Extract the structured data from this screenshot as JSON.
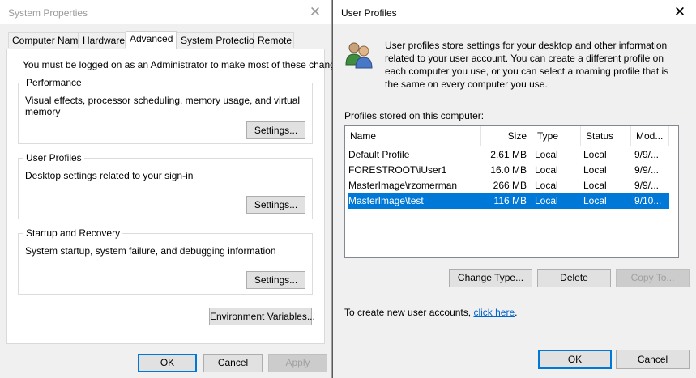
{
  "system_properties": {
    "title": "System Properties",
    "tabs": [
      {
        "label": "Computer Name"
      },
      {
        "label": "Hardware"
      },
      {
        "label": "Advanced"
      },
      {
        "label": "System Protection"
      },
      {
        "label": "Remote"
      }
    ],
    "admin_note": "You must be logged on as an Administrator to make most of these changes.",
    "performance": {
      "label": "Performance",
      "description": "Visual effects, processor scheduling, memory usage, and virtual memory",
      "button": "Settings..."
    },
    "user_profiles": {
      "label": "User Profiles",
      "description": "Desktop settings related to your sign-in",
      "button": "Settings..."
    },
    "startup_recovery": {
      "label": "Startup and Recovery",
      "description": "System startup, system failure, and debugging information",
      "button": "Settings..."
    },
    "env_button": "Environment Variables...",
    "ok": "OK",
    "cancel": "Cancel",
    "apply": "Apply"
  },
  "user_profiles_dialog": {
    "title": "User Profiles",
    "description": "User profiles store settings for your desktop and other information related to your user account. You can create a different profile on each computer you use, or you can select a roaming profile that is the same on every computer you use.",
    "profiles_label": "Profiles stored on this computer:",
    "columns": [
      "Name",
      "Size",
      "Type",
      "Status",
      "Mod..."
    ],
    "rows": [
      {
        "name": "Default Profile",
        "size": "2.61 MB",
        "type": "Local",
        "status": "Local",
        "modified": "9/9/..."
      },
      {
        "name": "FORESTROOT\\iUser1",
        "size": "16.0 MB",
        "type": "Local",
        "status": "Local",
        "modified": "9/9/..."
      },
      {
        "name": "MasterImage\\rzomerman",
        "size": "266 MB",
        "type": "Local",
        "status": "Local",
        "modified": "9/9/..."
      },
      {
        "name": "MasterImage\\test",
        "size": "116 MB",
        "type": "Local",
        "status": "Local",
        "modified": "9/10..."
      }
    ],
    "selected_row": 3,
    "change_type": "Change Type...",
    "delete": "Delete",
    "copy_to": "Copy To...",
    "create_text": "To create new user accounts,",
    "create_link": "click here",
    "create_end": ".",
    "ok": "OK",
    "cancel": "Cancel"
  }
}
